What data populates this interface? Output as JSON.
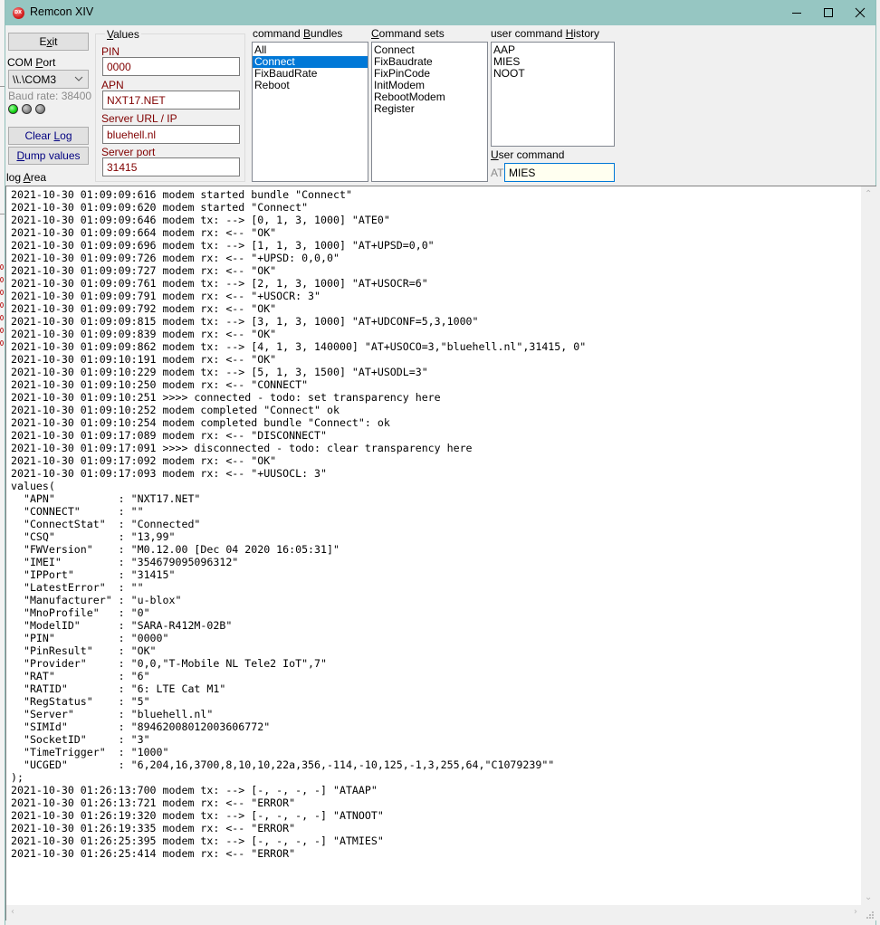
{
  "window": {
    "title": "Remcon XIV",
    "controls": {
      "minimize": "minimize",
      "maximize": "maximize",
      "close": "close"
    }
  },
  "left_panel": {
    "exit_button": {
      "pre": "E",
      "accel": "x",
      "post": "it"
    },
    "com_port_label": {
      "pre": "COM ",
      "accel": "P",
      "post": "ort"
    },
    "com_port_value": "\\\\.\\COM3",
    "baud_rate": "Baud rate: 38400",
    "status_leds": [
      {
        "name": "led-1",
        "state": "on",
        "color": "#10d010"
      },
      {
        "name": "led-2",
        "state": "off",
        "color": "#8a8a8a"
      },
      {
        "name": "led-3",
        "state": "off",
        "color": "#8a8a8a"
      }
    ],
    "clear_log_button": {
      "pre": "Clear ",
      "accel": "L",
      "post": "og"
    },
    "dump_values_button": {
      "pre": "",
      "accel": "D",
      "post": "ump values"
    },
    "log_area_label": {
      "pre": "log ",
      "accel": "A",
      "post": "rea"
    }
  },
  "values_group": {
    "title": {
      "pre": "",
      "accel": "V",
      "post": "alues"
    },
    "fields": [
      {
        "label": "PIN",
        "value": "0000"
      },
      {
        "label": "APN",
        "value": "NXT17.NET"
      },
      {
        "label": "Server URL / IP",
        "value": "bluehell.nl"
      },
      {
        "label": "Server port",
        "value": "31415"
      }
    ],
    "label_color": "#800000"
  },
  "command_bundles": {
    "label": {
      "pre": "command ",
      "accel": "B",
      "post": "undles"
    },
    "items": [
      "All",
      "Connect",
      "FixBaudRate",
      "Reboot"
    ],
    "selected": "Connect"
  },
  "command_sets": {
    "label": {
      "pre": "",
      "accel": "C",
      "post": "ommand sets"
    },
    "items": [
      "Connect",
      "FixBaudrate",
      "FixPinCode",
      "InitModem",
      "RebootModem",
      "Register"
    ]
  },
  "user_command_history": {
    "label": {
      "pre": "user command ",
      "accel": "H",
      "post": "istory"
    },
    "items": [
      "AAP",
      "MIES",
      "NOOT"
    ]
  },
  "user_command": {
    "label": {
      "pre": "",
      "accel": "U",
      "post": "ser command"
    },
    "prefix": "AT",
    "value": "MIES"
  },
  "log": {
    "lines": [
      "2021-10-30 01:09:09:616 modem started bundle \"Connect\"",
      "2021-10-30 01:09:09:620 modem started \"Connect\"",
      "2021-10-30 01:09:09:646 modem tx: --> [0, 1, 3, 1000] \"ATE0\"",
      "2021-10-30 01:09:09:664 modem rx: <-- \"OK\"",
      "2021-10-30 01:09:09:696 modem tx: --> [1, 1, 3, 1000] \"AT+UPSD=0,0\"",
      "2021-10-30 01:09:09:726 modem rx: <-- \"+UPSD: 0,0,0\"",
      "2021-10-30 01:09:09:727 modem rx: <-- \"OK\"",
      "2021-10-30 01:09:09:761 modem tx: --> [2, 1, 3, 1000] \"AT+USOCR=6\"",
      "2021-10-30 01:09:09:791 modem rx: <-- \"+USOCR: 3\"",
      "2021-10-30 01:09:09:792 modem rx: <-- \"OK\"",
      "2021-10-30 01:09:09:815 modem tx: --> [3, 1, 3, 1000] \"AT+UDCONF=5,3,1000\"",
      "2021-10-30 01:09:09:839 modem rx: <-- \"OK\"",
      "2021-10-30 01:09:09:862 modem tx: --> [4, 1, 3, 140000] \"AT+USOCO=3,\"bluehell.nl\",31415, 0\"",
      "2021-10-30 01:09:10:191 modem rx: <-- \"OK\"",
      "2021-10-30 01:09:10:229 modem tx: --> [5, 1, 3, 1500] \"AT+USODL=3\"",
      "2021-10-30 01:09:10:250 modem rx: <-- \"CONNECT\"",
      "2021-10-30 01:09:10:251 >>>> connected - todo: set transparency here",
      "2021-10-30 01:09:10:252 modem completed \"Connect\" ok",
      "2021-10-30 01:09:10:254 modem completed bundle \"Connect\": ok",
      "2021-10-30 01:09:17:089 modem rx: <-- \"DISCONNECT\"",
      "2021-10-30 01:09:17:091 >>>> disconnected - todo: clear transparency here",
      "2021-10-30 01:09:17:092 modem rx: <-- \"OK\"",
      "2021-10-30 01:09:17:093 modem rx: <-- \"+UUSOCL: 3\"",
      "values(",
      "  \"APN\"          : \"NXT17.NET\"",
      "  \"CONNECT\"      : \"\"",
      "  \"ConnectStat\"  : \"Connected\"",
      "  \"CSQ\"          : \"13,99\"",
      "  \"FWVersion\"    : \"M0.12.00 [Dec 04 2020 16:05:31]\"",
      "  \"IMEI\"         : \"354679095096312\"",
      "  \"IPPort\"       : \"31415\"",
      "  \"LatestError\"  : \"\"",
      "  \"Manufacturer\" : \"u-blox\"",
      "  \"MnoProfile\"   : \"0\"",
      "  \"ModelID\"      : \"SARA-R412M-02B\"",
      "  \"PIN\"          : \"0000\"",
      "  \"PinResult\"    : \"OK\"",
      "  \"Provider\"     : \"0,0,\"T-Mobile NL Tele2 IoT\",7\"",
      "  \"RAT\"          : \"6\"",
      "  \"RATID\"        : \"6: LTE Cat M1\"",
      "  \"RegStatus\"    : \"5\"",
      "  \"Server\"       : \"bluehell.nl\"",
      "  \"SIMId\"        : \"89462008012003606772\"",
      "  \"SocketID\"     : \"3\"",
      "  \"TimeTrigger\"  : \"1000\"",
      "  \"UCGED\"        : \"6,204,16,3700,8,10,10,22a,356,-114,-10,125,-1,3,255,64,\"C1079239\"\"",
      ");",
      "2021-10-30 01:26:13:700 modem tx: --> [-, -, -, -] \"ATAAP\"",
      "2021-10-30 01:26:13:721 modem rx: <-- \"ERROR\"",
      "2021-10-30 01:26:19:320 modem tx: --> [-, -, -, -] \"ATNOOT\"",
      "2021-10-30 01:26:19:335 modem rx: <-- \"ERROR\"",
      "2021-10-30 01:26:25:395 modem tx: --> [-, -, -, -] \"ATMIES\"",
      "2021-10-30 01:26:25:414 modem rx: <-- \"ERROR\""
    ]
  },
  "colors": {
    "titlebar": "#96c6c2",
    "selection": "#0078d7",
    "field_text": "#800000",
    "link_button_text": "#000080",
    "user_command_bg": "#fffff0"
  }
}
